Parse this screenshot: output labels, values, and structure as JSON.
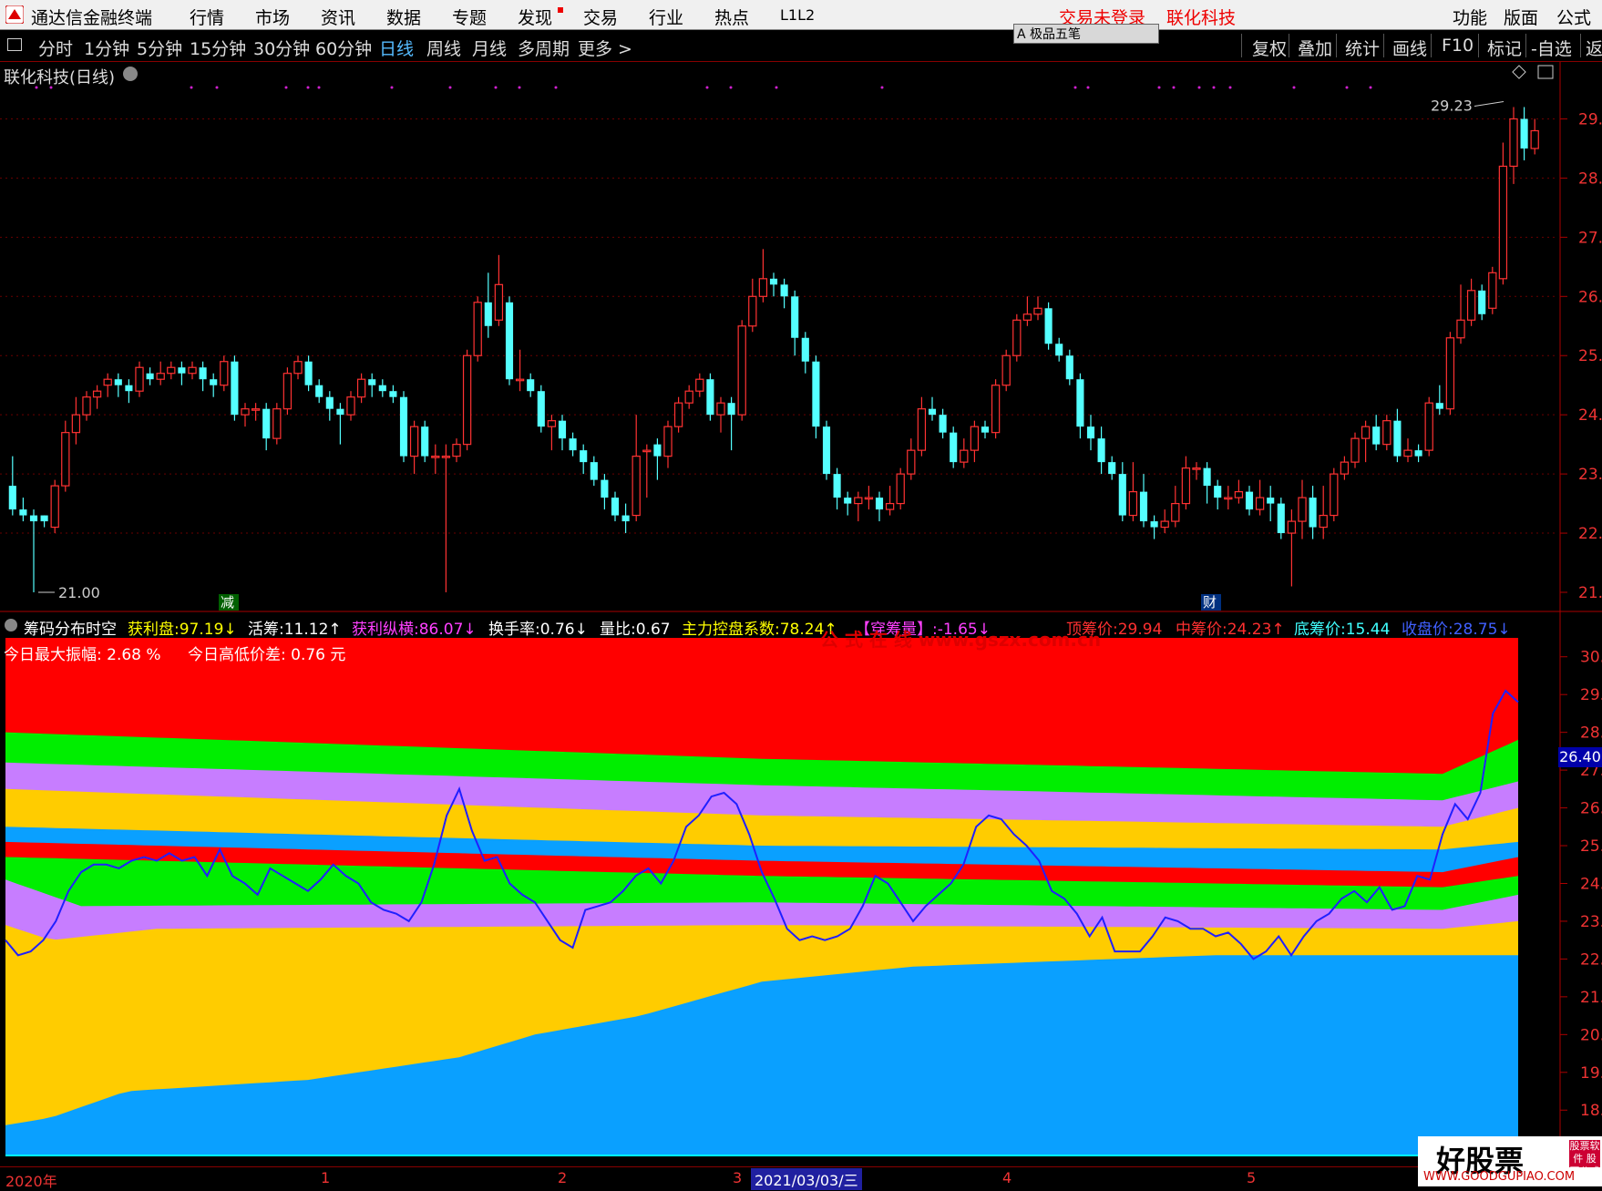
{
  "app": {
    "name": "通达信金融终端",
    "menu": [
      "行情",
      "市场",
      "资讯",
      "数据",
      "专题",
      "发现",
      "交易",
      "行业",
      "热点",
      "L1L2"
    ],
    "login_status": "交易未登录",
    "stock_name_header": "联化科技",
    "right_menu": [
      "功能",
      "版面",
      "公式"
    ]
  },
  "toolbar": {
    "periods": [
      "分时",
      "1分钟",
      "5分钟",
      "15分钟",
      "30分钟",
      "60分钟",
      "日线",
      "周线",
      "月线",
      "多周期",
      "更多 >"
    ],
    "active_period": "日线",
    "pen_box": "A 极品五笔",
    "tools": [
      "复权",
      "叠加",
      "统计",
      "画线",
      "F10",
      "标记",
      "-自选",
      "返"
    ]
  },
  "main_chart": {
    "title": "联化科技(日线)",
    "high_label": "29.23",
    "low_label": "21.00",
    "marker_reduce": "减",
    "marker_finance": "财",
    "y_ticks": [
      "29.",
      "28.",
      "27.",
      "26.",
      "25.",
      "24.",
      "23.",
      "22.",
      "21."
    ]
  },
  "indicator": {
    "name": "筹码分布时空",
    "items": [
      {
        "label": "获利盘:",
        "value": "97.19",
        "arrow": "↓",
        "color": "#ffff00"
      },
      {
        "label": "活筹:",
        "value": "11.12",
        "arrow": "↑",
        "color": "#ffffff"
      },
      {
        "label": "获利纵横:",
        "value": "86.07",
        "arrow": "↓",
        "color": "#ff40ff"
      },
      {
        "label": "换手率:",
        "value": "0.76",
        "arrow": "↓",
        "color": "#ffffff"
      },
      {
        "label": "量比:",
        "value": "0.67",
        "arrow": "",
        "color": "#ffffff"
      },
      {
        "label": "主力控盘系数:",
        "value": "78.24",
        "arrow": "↑",
        "color": "#ffff00"
      },
      {
        "label": "【穿筹量】:",
        "value": "-1.65",
        "arrow": "↓",
        "color": "#ff40ff"
      },
      {
        "label": "顶筹价:",
        "value": "29.94",
        "arrow": "",
        "color": "#ff3030"
      },
      {
        "label": "中筹价:",
        "value": "24.23",
        "arrow": "↑",
        "color": "#ff3030"
      },
      {
        "label": "底筹价:",
        "value": "15.44",
        "arrow": "",
        "color": "#40ffff"
      },
      {
        "label": "收盘价:",
        "value": "28.75",
        "arrow": "↓",
        "color": "#4060ff"
      }
    ],
    "amplitude_label": "今日最大振幅: 2.68 %",
    "hl_diff_label": "今日高低价差: 0.76 元",
    "watermark_text": "公 式 在 线 www.gszx.com.cn",
    "current_price_tag": "26.40",
    "y_ticks": [
      "30.",
      "29.",
      "28.",
      "27.",
      "26.",
      "25.",
      "24.",
      "23.",
      "22.",
      "21.",
      "20.",
      "19.",
      "18.",
      "17."
    ]
  },
  "x_axis": [
    "2020年",
    "1",
    "2",
    "3",
    "2021/03/03/三",
    "4",
    "5"
  ],
  "site_watermark": {
    "title": "好股票",
    "badge": "股票软件 股票公式",
    "url": "WWW.GOODGUPIAO.COM"
  },
  "colors": {
    "up": "#ff3232",
    "down": "#54ffff",
    "band_red": "#ff0000",
    "band_green": "#00ee00",
    "band_violet": "#c77dff",
    "band_yellow": "#ffcc00",
    "band_blue": "#0aa0ff",
    "close_line": "#2020ff"
  },
  "chart_data": {
    "type": "candlestick",
    "ylim": [
      21.0,
      29.5
    ],
    "candles": [
      [
        22.8,
        22.4,
        23.3,
        22.3
      ],
      [
        22.4,
        22.3,
        22.6,
        22.2
      ],
      [
        22.3,
        22.2,
        22.4,
        21.0
      ],
      [
        22.3,
        22.2,
        22.3,
        22.1
      ],
      [
        22.1,
        22.8,
        22.9,
        22.0
      ],
      [
        22.8,
        23.7,
        23.9,
        22.7
      ],
      [
        23.7,
        24.0,
        24.3,
        23.5
      ],
      [
        24.0,
        24.3,
        24.4,
        23.9
      ],
      [
        24.3,
        24.4,
        24.5,
        24.1
      ],
      [
        24.5,
        24.6,
        24.7,
        24.3
      ],
      [
        24.6,
        24.5,
        24.7,
        24.3
      ],
      [
        24.5,
        24.4,
        24.6,
        24.2
      ],
      [
        24.4,
        24.8,
        24.9,
        24.3
      ],
      [
        24.7,
        24.6,
        24.8,
        24.5
      ],
      [
        24.6,
        24.7,
        24.9,
        24.5
      ],
      [
        24.7,
        24.8,
        24.9,
        24.6
      ],
      [
        24.8,
        24.7,
        24.9,
        24.5
      ],
      [
        24.7,
        24.8,
        24.9,
        24.6
      ],
      [
        24.8,
        24.6,
        24.9,
        24.4
      ],
      [
        24.6,
        24.5,
        24.7,
        24.3
      ],
      [
        24.5,
        24.9,
        25.0,
        24.4
      ],
      [
        24.9,
        24.0,
        25.0,
        23.9
      ],
      [
        24.0,
        24.1,
        24.2,
        23.8
      ],
      [
        24.1,
        24.1,
        24.2,
        23.9
      ],
      [
        24.1,
        23.6,
        24.2,
        23.4
      ],
      [
        23.6,
        24.1,
        24.2,
        23.5
      ],
      [
        24.1,
        24.7,
        24.8,
        24.0
      ],
      [
        24.7,
        24.9,
        25.0,
        24.6
      ],
      [
        24.9,
        24.5,
        25.0,
        24.4
      ],
      [
        24.5,
        24.3,
        24.6,
        24.2
      ],
      [
        24.3,
        24.1,
        24.4,
        23.9
      ],
      [
        24.1,
        24.0,
        24.2,
        23.5
      ],
      [
        24.0,
        24.3,
        24.4,
        23.9
      ],
      [
        24.3,
        24.6,
        24.7,
        24.2
      ],
      [
        24.6,
        24.5,
        24.7,
        24.3
      ],
      [
        24.5,
        24.4,
        24.6,
        24.3
      ],
      [
        24.4,
        24.3,
        24.5,
        24.2
      ],
      [
        24.3,
        23.3,
        24.4,
        23.2
      ],
      [
        23.3,
        23.8,
        23.9,
        23.0
      ],
      [
        23.8,
        23.3,
        23.9,
        23.2
      ],
      [
        23.3,
        23.3,
        23.5,
        23.0
      ],
      [
        23.3,
        23.3,
        23.5,
        21.0
      ],
      [
        23.3,
        23.5,
        23.6,
        23.2
      ],
      [
        23.5,
        25.0,
        25.1,
        23.4
      ],
      [
        25.0,
        25.9,
        26.0,
        24.9
      ],
      [
        25.9,
        25.5,
        26.4,
        25.3
      ],
      [
        25.6,
        26.2,
        26.7,
        25.5
      ],
      [
        25.9,
        24.6,
        26.0,
        24.5
      ],
      [
        24.6,
        24.6,
        25.1,
        24.4
      ],
      [
        24.6,
        24.4,
        24.7,
        24.3
      ],
      [
        24.4,
        23.8,
        24.5,
        23.7
      ],
      [
        23.8,
        23.9,
        24.0,
        23.4
      ],
      [
        23.9,
        23.6,
        24.0,
        23.4
      ],
      [
        23.6,
        23.4,
        23.7,
        23.3
      ],
      [
        23.4,
        23.2,
        23.5,
        23.0
      ],
      [
        23.2,
        22.9,
        23.3,
        22.8
      ],
      [
        22.9,
        22.6,
        23.0,
        22.4
      ],
      [
        22.6,
        22.3,
        22.7,
        22.2
      ],
      [
        22.3,
        22.2,
        22.5,
        22.0
      ],
      [
        22.3,
        23.3,
        24.0,
        22.2
      ],
      [
        23.4,
        23.4,
        23.5,
        22.6
      ],
      [
        23.5,
        23.3,
        23.6,
        22.9
      ],
      [
        23.3,
        23.8,
        23.9,
        23.1
      ],
      [
        23.8,
        24.2,
        24.3,
        23.7
      ],
      [
        24.2,
        24.4,
        24.5,
        24.1
      ],
      [
        24.4,
        24.6,
        24.7,
        24.3
      ],
      [
        24.6,
        24.0,
        24.7,
        23.9
      ],
      [
        24.0,
        24.2,
        24.3,
        23.7
      ],
      [
        24.2,
        24.0,
        24.3,
        23.4
      ],
      [
        24.0,
        25.5,
        25.6,
        23.9
      ],
      [
        25.5,
        26.0,
        26.3,
        25.4
      ],
      [
        26.0,
        26.3,
        26.8,
        25.9
      ],
      [
        26.3,
        26.2,
        26.4,
        26.0
      ],
      [
        26.2,
        26.0,
        26.3,
        25.8
      ],
      [
        26.0,
        25.3,
        26.1,
        25.0
      ],
      [
        25.3,
        24.9,
        25.4,
        24.7
      ],
      [
        24.9,
        23.8,
        25.0,
        23.6
      ],
      [
        23.8,
        23.0,
        23.9,
        22.9
      ],
      [
        23.0,
        22.6,
        23.1,
        22.4
      ],
      [
        22.6,
        22.5,
        22.7,
        22.3
      ],
      [
        22.5,
        22.6,
        22.7,
        22.2
      ],
      [
        22.6,
        22.6,
        22.8,
        22.4
      ],
      [
        22.6,
        22.4,
        22.7,
        22.2
      ],
      [
        22.4,
        22.5,
        22.8,
        22.3
      ],
      [
        22.5,
        23.0,
        23.1,
        22.4
      ],
      [
        23.0,
        23.4,
        23.6,
        22.9
      ],
      [
        23.4,
        24.1,
        24.3,
        23.3
      ],
      [
        24.1,
        24.0,
        24.3,
        23.9
      ],
      [
        24.0,
        23.7,
        24.1,
        23.6
      ],
      [
        23.7,
        23.2,
        23.8,
        23.1
      ],
      [
        23.2,
        23.4,
        23.6,
        23.1
      ],
      [
        23.4,
        23.8,
        23.9,
        23.2
      ],
      [
        23.8,
        23.7,
        23.9,
        23.6
      ],
      [
        23.7,
        24.5,
        24.6,
        23.6
      ],
      [
        24.5,
        25.0,
        25.1,
        24.4
      ],
      [
        25.0,
        25.6,
        25.7,
        24.9
      ],
      [
        25.6,
        25.7,
        26.0,
        25.5
      ],
      [
        25.7,
        25.8,
        26.0,
        25.6
      ],
      [
        25.8,
        25.2,
        25.9,
        25.1
      ],
      [
        25.2,
        25.0,
        25.3,
        24.9
      ],
      [
        25.0,
        24.6,
        25.1,
        24.5
      ],
      [
        24.6,
        23.8,
        24.7,
        23.6
      ],
      [
        23.8,
        23.6,
        24.0,
        23.4
      ],
      [
        23.6,
        23.2,
        23.8,
        23.0
      ],
      [
        23.2,
        23.0,
        23.3,
        22.9
      ],
      [
        23.0,
        22.3,
        23.2,
        22.2
      ],
      [
        22.3,
        22.7,
        23.2,
        22.2
      ],
      [
        22.7,
        22.2,
        23.0,
        22.1
      ],
      [
        22.2,
        22.1,
        22.3,
        21.9
      ],
      [
        22.1,
        22.2,
        22.4,
        22.0
      ],
      [
        22.2,
        22.5,
        22.8,
        22.1
      ],
      [
        22.5,
        23.1,
        23.3,
        22.4
      ],
      [
        23.1,
        23.1,
        23.2,
        22.9
      ],
      [
        23.1,
        22.8,
        23.2,
        22.5
      ],
      [
        22.8,
        22.6,
        22.9,
        22.4
      ],
      [
        22.6,
        22.6,
        22.8,
        22.4
      ],
      [
        22.6,
        22.7,
        22.9,
        22.5
      ],
      [
        22.7,
        22.4,
        22.8,
        22.3
      ],
      [
        22.4,
        22.6,
        22.9,
        22.3
      ],
      [
        22.6,
        22.5,
        22.8,
        22.2
      ],
      [
        22.5,
        22.0,
        22.6,
        21.9
      ],
      [
        22.0,
        22.2,
        22.4,
        21.1
      ],
      [
        22.2,
        22.6,
        22.9,
        21.9
      ],
      [
        22.6,
        22.1,
        22.8,
        21.9
      ],
      [
        22.1,
        22.3,
        22.8,
        21.9
      ],
      [
        22.3,
        23.0,
        23.1,
        22.2
      ],
      [
        23.0,
        23.2,
        23.3,
        22.9
      ],
      [
        23.2,
        23.6,
        23.7,
        23.1
      ],
      [
        23.6,
        23.8,
        23.9,
        23.2
      ],
      [
        23.8,
        23.5,
        24.0,
        23.4
      ],
      [
        23.5,
        23.9,
        24.0,
        23.4
      ],
      [
        23.9,
        23.3,
        24.1,
        23.2
      ],
      [
        23.3,
        23.4,
        23.6,
        23.2
      ],
      [
        23.4,
        23.3,
        23.5,
        23.2
      ],
      [
        23.4,
        24.2,
        24.3,
        23.3
      ],
      [
        24.2,
        24.1,
        24.5,
        24.0
      ],
      [
        24.1,
        25.3,
        25.4,
        24.0
      ],
      [
        25.3,
        25.6,
        26.2,
        25.2
      ],
      [
        25.6,
        26.1,
        26.3,
        25.5
      ],
      [
        26.1,
        25.7,
        26.2,
        25.6
      ],
      [
        25.8,
        26.4,
        26.5,
        25.7
      ],
      [
        26.3,
        28.2,
        28.6,
        26.2
      ],
      [
        28.2,
        29.0,
        29.2,
        27.9
      ],
      [
        29.0,
        28.5,
        29.2,
        28.3
      ],
      [
        28.5,
        28.8,
        29.0,
        28.4
      ]
    ],
    "close_line_y": [
      22.5,
      22.1,
      22.2,
      22.5,
      23.0,
      23.8,
      24.3,
      24.5,
      24.5,
      24.4,
      24.6,
      24.7,
      24.6,
      24.8,
      24.6,
      24.7,
      24.2,
      24.9,
      24.2,
      24.0,
      23.7,
      24.4,
      24.2,
      24.0,
      23.8,
      24.1,
      24.5,
      24.2,
      24.0,
      23.5,
      23.3,
      23.2,
      23.0,
      23.5,
      24.5,
      25.8,
      26.5,
      25.4,
      24.6,
      24.7,
      24.0,
      23.7,
      23.5,
      23.0,
      22.5,
      22.3,
      23.3,
      23.4,
      23.5,
      23.8,
      24.2,
      24.4,
      24.0,
      24.6,
      25.5,
      25.8,
      26.3,
      26.4,
      26.1,
      25.3,
      24.3,
      23.6,
      22.8,
      22.5,
      22.6,
      22.5,
      22.6,
      22.8,
      23.4,
      24.2,
      24.0,
      23.5,
      23.0,
      23.4,
      23.7,
      24.0,
      24.5,
      25.5,
      25.8,
      25.7,
      25.3,
      25.0,
      24.6,
      23.8,
      23.6,
      23.2,
      22.6,
      23.1,
      22.2,
      22.2,
      22.2,
      22.6,
      23.1,
      23.0,
      22.8,
      22.8,
      22.6,
      22.7,
      22.4,
      22.0,
      22.2,
      22.6,
      22.1,
      22.6,
      23.0,
      23.2,
      23.6,
      23.8,
      23.5,
      23.9,
      23.3,
      23.4,
      24.2,
      24.1,
      25.3,
      26.1,
      25.7,
      26.4,
      28.5,
      29.1,
      28.8
    ]
  }
}
